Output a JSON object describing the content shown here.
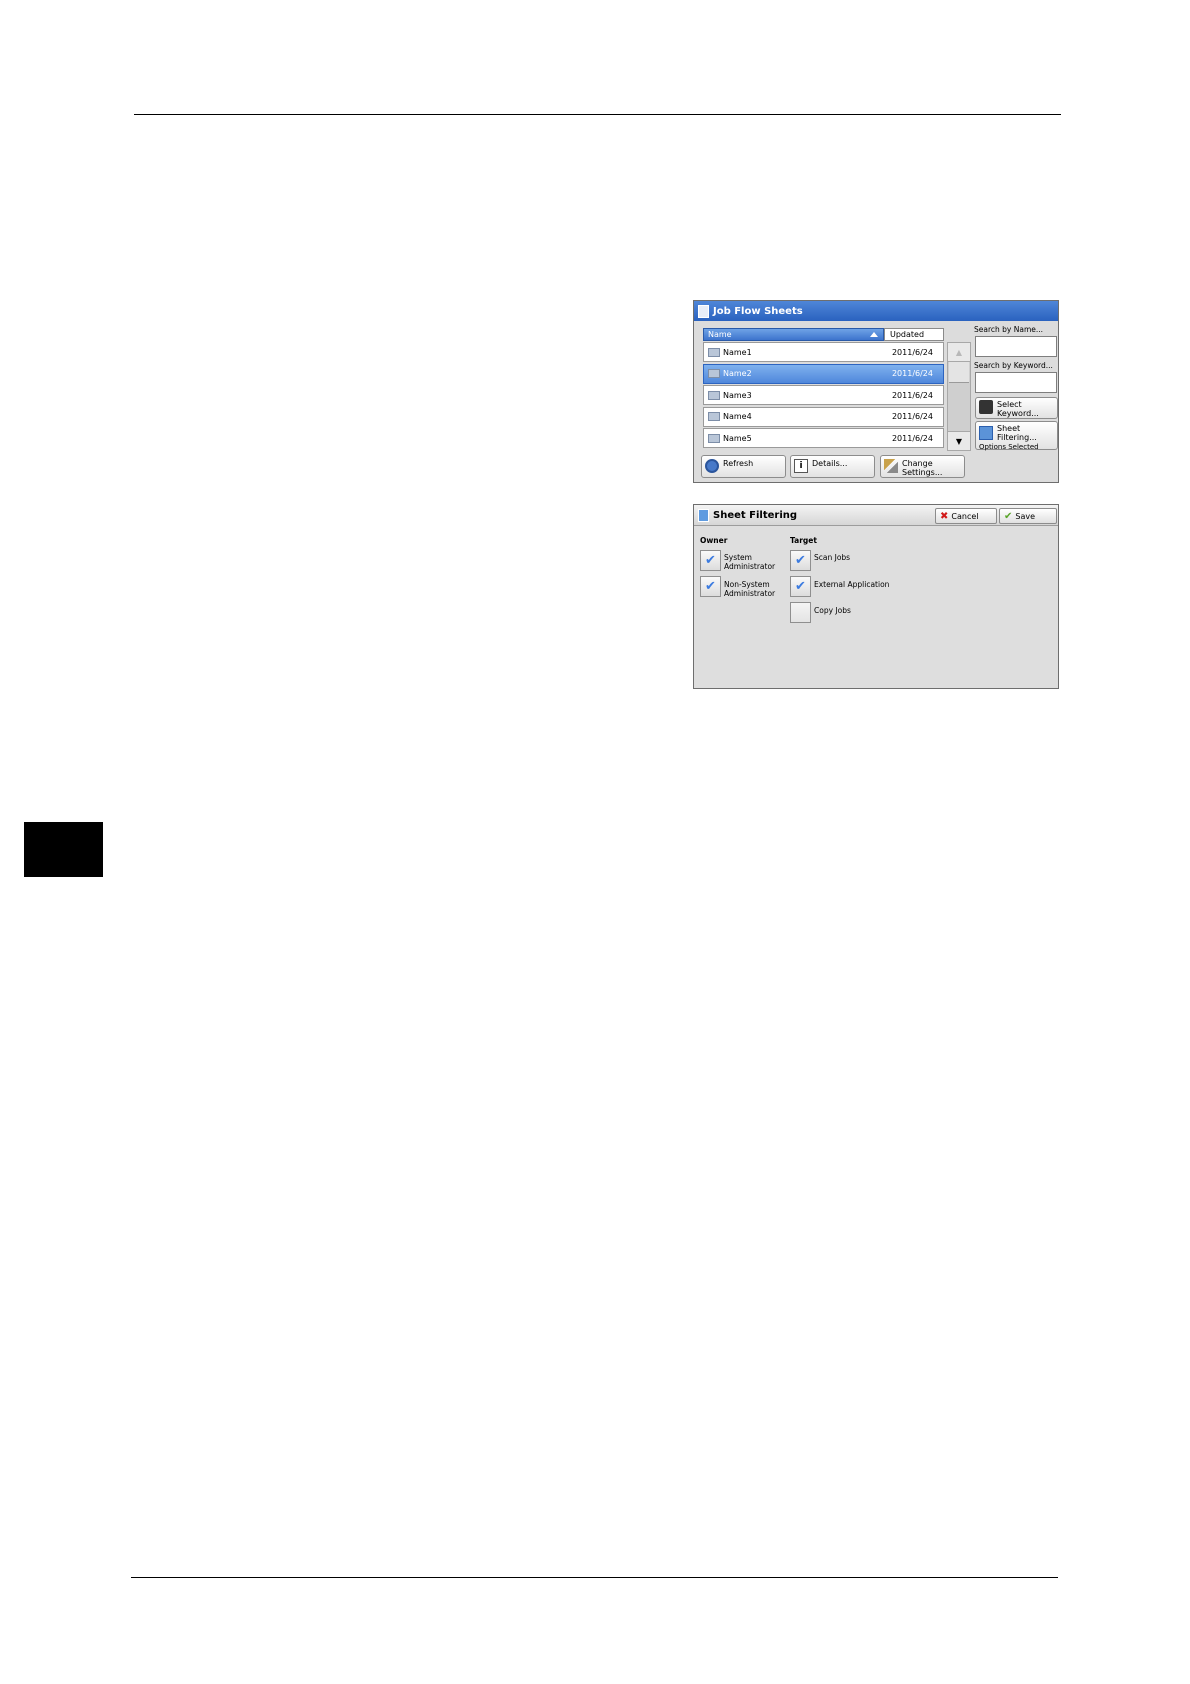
{
  "job_flow_sheets": {
    "title": "Job Flow Sheets",
    "columns": {
      "name": "Name",
      "updated": "Updated"
    },
    "rows": [
      {
        "name": "Name1",
        "date": "2011/6/24",
        "selected": false
      },
      {
        "name": "Name2",
        "date": "2011/6/24",
        "selected": true
      },
      {
        "name": "Name3",
        "date": "2011/6/24",
        "selected": false
      },
      {
        "name": "Name4",
        "date": "2011/6/24",
        "selected": false
      },
      {
        "name": "Name5",
        "date": "2011/6/24",
        "selected": false
      }
    ],
    "scroll_up": "▲",
    "scroll_down": "▼",
    "search_by_name": "Search by Name...",
    "search_by_keyword": "Search by Keyword...",
    "select_keyword": "Select Keyword...",
    "sheet_filtering": "Sheet Filtering...",
    "options_selected": "Options Selected",
    "refresh": "Refresh",
    "details": "Details...",
    "change_settings": "Change Settings...",
    "info_glyph": "i"
  },
  "sheet_filtering_dialog": {
    "title": "Sheet Filtering",
    "cancel": "Cancel",
    "save": "Save",
    "cancel_glyph": "✖",
    "save_glyph": "✔",
    "check_glyph": "✔",
    "owner_label": "Owner",
    "target_label": "Target",
    "owner_options": [
      {
        "label": "System Administrator",
        "checked": true
      },
      {
        "label": "Non-System Administrator",
        "checked": true
      }
    ],
    "target_options": [
      {
        "label": "Scan Jobs",
        "checked": true
      },
      {
        "label": "External Application",
        "checked": true
      },
      {
        "label": "Copy Jobs",
        "checked": false
      }
    ]
  }
}
